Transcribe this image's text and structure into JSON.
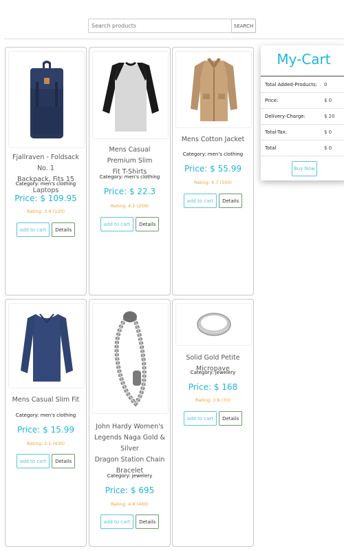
{
  "search": {
    "placeholder": "Search products",
    "button_label": "SEARCH"
  },
  "products": [
    {
      "title_lines": [
        "Fjallraven - Foldsack No. 1",
        "Backpack, Fits 15 Laptops"
      ],
      "category": "Category: men's clothing",
      "price": "Price: $ 109.95",
      "rating": "Rating: 3.9 (120)",
      "image_icon": "backpack-icon"
    },
    {
      "title_lines": [
        "Mens Casual Premium Slim",
        "Fit T-Shirts"
      ],
      "category": "Category: men's clothing",
      "price": "Price: $ 22.3",
      "rating": "Rating: 4.1 (259)",
      "image_icon": "raglan-shirt-icon"
    },
    {
      "title_lines": [
        "Mens Cotton Jacket"
      ],
      "category": "Category: men's clothing",
      "price": "Price: $ 55.99",
      "rating": "Rating: 4.7 (500)",
      "image_icon": "jacket-icon"
    },
    {
      "title_lines": [
        "Mens Casual Slim Fit"
      ],
      "category": "Category: men's clothing",
      "price": "Price: $ 15.99",
      "rating": "Rating: 2.1 (430)",
      "image_icon": "long-sleeve-shirt-icon"
    },
    {
      "title_lines": [
        "John Hardy Women's",
        "Legends Naga Gold & Silver",
        "Dragon Station Chain",
        "Bracelet"
      ],
      "category": "Category: jewelery",
      "price": "Price: $ 695",
      "rating": "Rating: 4.6 (400)",
      "image_icon": "chain-bracelet-icon"
    },
    {
      "title_lines": [
        "Solid Gold Petite Micropave"
      ],
      "category": "Category: jewelery",
      "price": "Price: $ 168",
      "rating": "Rating: 3.9 (70)",
      "image_icon": "ring-icon"
    }
  ],
  "buttons": {
    "add_to_cart": "add to cart",
    "details": "Details"
  },
  "cart": {
    "title": "My-Cart",
    "rows": [
      {
        "label": "Total Added-Products:",
        "value": "0"
      },
      {
        "label": "Price:",
        "value": "$ 0"
      },
      {
        "label": "Delivery-Charge:",
        "value": "$ 20"
      },
      {
        "label": "Total-Tax:",
        "value": "$ 0"
      },
      {
        "label": "Total",
        "value": "$ 0"
      }
    ],
    "buy_label": "Buy Now"
  },
  "colors": {
    "accent": "#1fb6d8",
    "rating": "#f0a030",
    "details_border": "#6a9a6a"
  }
}
